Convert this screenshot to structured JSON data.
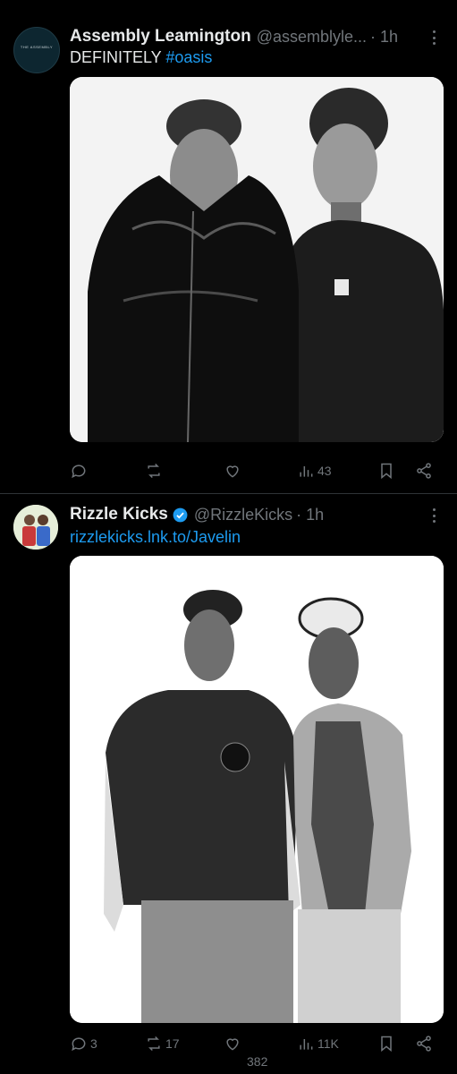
{
  "posts": [
    {
      "name": "Assembly Leamington",
      "handle": "@assemblyle...",
      "time": "· 1h",
      "avatar_text": "THE ASSEMBLY",
      "text_prefix": "DEFINITELY ",
      "hashtag": "#oasis",
      "actions": {
        "replies": "",
        "reposts": "",
        "likes": "",
        "views": "43"
      }
    },
    {
      "name": "Rizzle Kicks",
      "handle": "@RizzleKicks",
      "time": "· 1h",
      "verified": true,
      "link": "rizzlekicks.lnk.to/Javelin",
      "actions": {
        "replies": "3",
        "reposts": "17",
        "likes": "382",
        "views": "11K"
      }
    }
  ],
  "colors": {
    "accent": "#1d9bf0",
    "muted": "#71767b",
    "background": "#000000"
  }
}
